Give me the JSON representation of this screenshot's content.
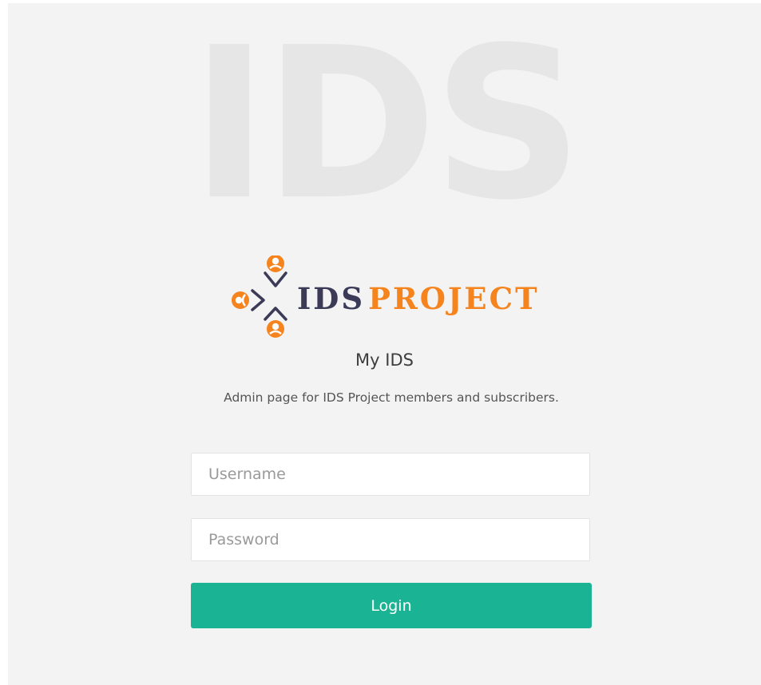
{
  "watermark": "IDS",
  "logo": {
    "name_part1": "IDS",
    "name_part2": "PROJECT",
    "icon": "ids-project-logo-icon",
    "colors": {
      "orange": "#f5841f",
      "navy": "#3b3a57"
    }
  },
  "title": "My IDS",
  "subtitle": "Admin page for IDS Project members and subscribers.",
  "form": {
    "username_placeholder": "Username",
    "username_value": "",
    "password_placeholder": "Password",
    "password_value": "",
    "login_label": "Login"
  },
  "colors": {
    "accent": "#1ab394",
    "background": "#f3f3f3"
  }
}
